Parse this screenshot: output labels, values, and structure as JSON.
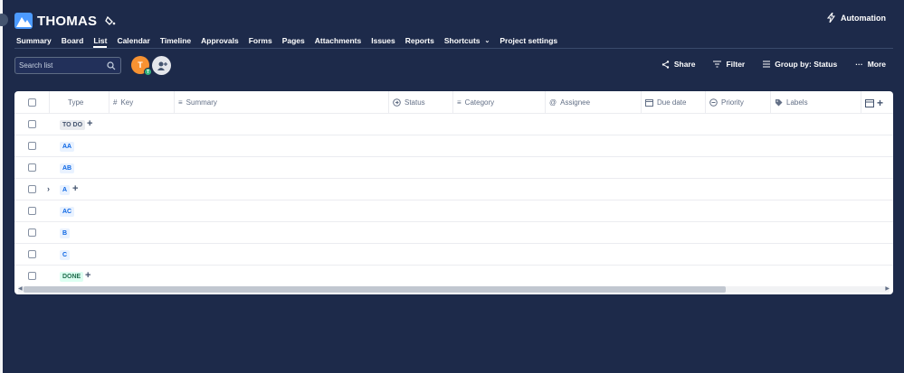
{
  "project": {
    "title": "THOMAS"
  },
  "automation_label": "Automation",
  "tabs": [
    "Summary",
    "Board",
    "List",
    "Calendar",
    "Timeline",
    "Approvals",
    "Forms",
    "Pages",
    "Attachments",
    "Issues",
    "Reports",
    "Shortcuts",
    "Project settings"
  ],
  "active_tab": "List",
  "search": {
    "placeholder": "Search list"
  },
  "avatar": {
    "initial": "T",
    "badge": "T"
  },
  "actions": {
    "share": "Share",
    "filter": "Filter",
    "group_by": "Group by: Status",
    "more": "More"
  },
  "columns": [
    "Type",
    "Key",
    "Summary",
    "Status",
    "Category",
    "Assignee",
    "Due date",
    "Priority",
    "Labels"
  ],
  "groups": [
    {
      "label": "TO DO",
      "style": "gray"
    },
    {
      "label": "AA",
      "style": "blue"
    },
    {
      "label": "AB",
      "style": "blue"
    },
    {
      "label": "A",
      "style": "blue"
    },
    {
      "label": "AC",
      "style": "blue"
    },
    {
      "label": "B",
      "style": "blue"
    },
    {
      "label": "C",
      "style": "blue"
    },
    {
      "label": "DONE",
      "style": "green"
    }
  ],
  "colors": {
    "background": "#1d2a4a",
    "accent": "#4c9aff",
    "panel": "#ffffff"
  }
}
